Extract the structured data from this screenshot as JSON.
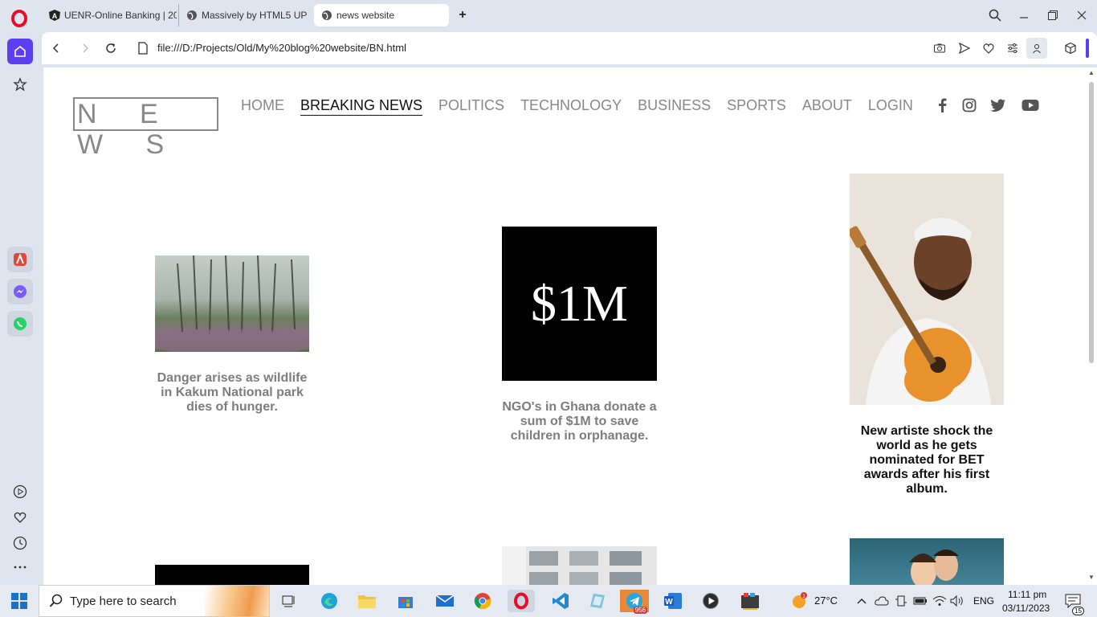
{
  "browser": {
    "tabs": [
      {
        "title": "UENR-Online Banking | 20"
      },
      {
        "title": "Massively by HTML5 UP"
      },
      {
        "title": "news website"
      }
    ],
    "url": "file:///D:/Projects/Old/My%20blog%20website/BN.html"
  },
  "site": {
    "logo": "N E W S",
    "nav": [
      "HOME",
      "BREAKING NEWS",
      "POLITICS",
      "TECHNOLOGY",
      "BUSINESS",
      "SPORTS",
      "ABOUT",
      "LOGIN"
    ],
    "active_nav": "BREAKING NEWS",
    "articles": [
      {
        "caption": "Danger arises as wildlife in Kakum National park dies of hunger."
      },
      {
        "caption": "NGO's in Ghana donate a sum of $1M to save children in orphanage.",
        "image_text": "$1M"
      },
      {
        "caption": "New artiste shock the world as he gets nominated for BET awards after his first album."
      }
    ]
  },
  "taskbar": {
    "search_placeholder": "Type here to search",
    "telegram_badge": "956",
    "weather": "27°C",
    "language": "ENG",
    "time": "11:11 pm",
    "date": "03/11/2023",
    "notifications": "15"
  }
}
